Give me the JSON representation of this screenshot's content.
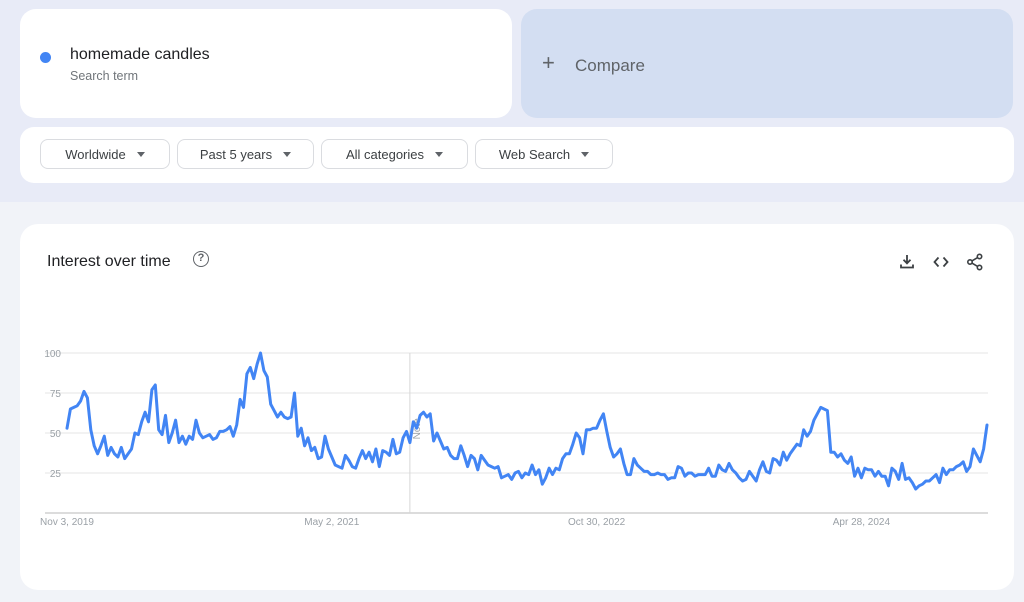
{
  "search_term": {
    "name": "homemade candles",
    "subtitle": "Search term",
    "color": "#4285f4"
  },
  "compare": {
    "icon": "plus-icon",
    "label": "Compare"
  },
  "filters": [
    {
      "label": "Worldwide",
      "icon": "caret-down-icon"
    },
    {
      "label": "Past 5 years",
      "icon": "caret-down-icon"
    },
    {
      "label": "All categories",
      "icon": "caret-down-icon"
    },
    {
      "label": "Web Search",
      "icon": "caret-down-icon"
    }
  ],
  "panel": {
    "title": "Interest over time",
    "help_icon": "help-circle-icon",
    "help_glyph": "?",
    "actions": [
      "download-icon",
      "embed-code-icon",
      "share-icon"
    ]
  },
  "chart_data": {
    "type": "line",
    "title": "Interest over time",
    "xlabel": "",
    "ylabel": "",
    "ylim": [
      0,
      100
    ],
    "yticks": [
      25,
      50,
      75,
      100
    ],
    "xticks": [
      "Nov 3, 2019",
      "May 2, 2021",
      "Oct 30, 2022",
      "Apr 28, 2024"
    ],
    "xtick_positions_weeks": [
      0,
      78,
      156,
      234
    ],
    "grid": true,
    "annotations": [
      {
        "label": "Note",
        "at_week": 101
      }
    ],
    "series": [
      {
        "name": "homemade candles",
        "color": "#4285f4",
        "values": [
          53,
          65,
          66,
          67,
          70,
          76,
          72,
          52,
          42,
          37,
          42,
          48,
          36,
          41,
          37,
          35,
          41,
          34,
          37,
          40,
          50,
          49,
          57,
          63,
          57,
          77,
          80,
          52,
          49,
          61,
          44,
          50,
          58,
          44,
          48,
          43,
          48,
          46,
          58,
          50,
          47,
          48,
          49,
          46,
          47,
          51,
          51,
          52,
          54,
          48,
          55,
          71,
          66,
          87,
          91,
          84,
          93,
          100,
          89,
          85,
          68,
          64,
          60,
          63,
          60,
          59,
          60,
          75,
          48,
          53,
          42,
          47,
          39,
          41,
          34,
          35,
          48,
          40,
          35,
          30,
          29,
          28,
          36,
          33,
          29,
          28,
          34,
          39,
          34,
          38,
          32,
          40,
          29,
          39,
          38,
          36,
          46,
          37,
          38,
          47,
          51,
          44,
          57,
          53,
          61,
          63,
          60,
          62,
          45,
          50,
          45,
          40,
          41,
          36,
          34,
          34,
          42,
          36,
          29,
          36,
          34,
          27,
          36,
          33,
          30,
          29,
          28,
          29,
          22,
          23,
          24,
          21,
          25,
          26,
          22,
          25,
          24,
          30,
          24,
          27,
          18,
          22,
          28,
          24,
          28,
          27,
          34,
          37,
          37,
          43,
          50,
          47,
          37,
          52,
          52,
          53,
          53,
          58,
          62,
          51,
          41,
          35,
          37,
          40,
          31,
          24,
          24,
          34,
          30,
          28,
          26,
          26,
          24,
          24,
          25,
          24,
          24,
          21,
          22,
          22,
          29,
          28,
          23,
          25,
          25,
          23,
          24,
          24,
          24,
          28,
          23,
          23,
          30,
          27,
          26,
          31,
          27,
          25,
          22,
          20,
          21,
          26,
          23,
          20,
          27,
          32,
          26,
          25,
          34,
          33,
          30,
          38,
          33,
          37,
          40,
          43,
          42,
          52,
          48,
          51,
          58,
          62,
          66,
          65,
          64,
          38,
          38,
          35,
          37,
          33,
          31,
          35,
          23,
          28,
          22,
          28,
          27,
          27,
          23,
          26,
          23,
          23,
          17,
          28,
          26,
          21,
          31,
          21,
          22,
          19,
          15,
          17,
          18,
          20,
          20,
          22,
          24,
          19,
          28,
          24,
          27,
          27,
          29,
          30,
          32,
          26,
          29,
          40,
          36,
          32,
          40,
          55
        ]
      }
    ]
  }
}
